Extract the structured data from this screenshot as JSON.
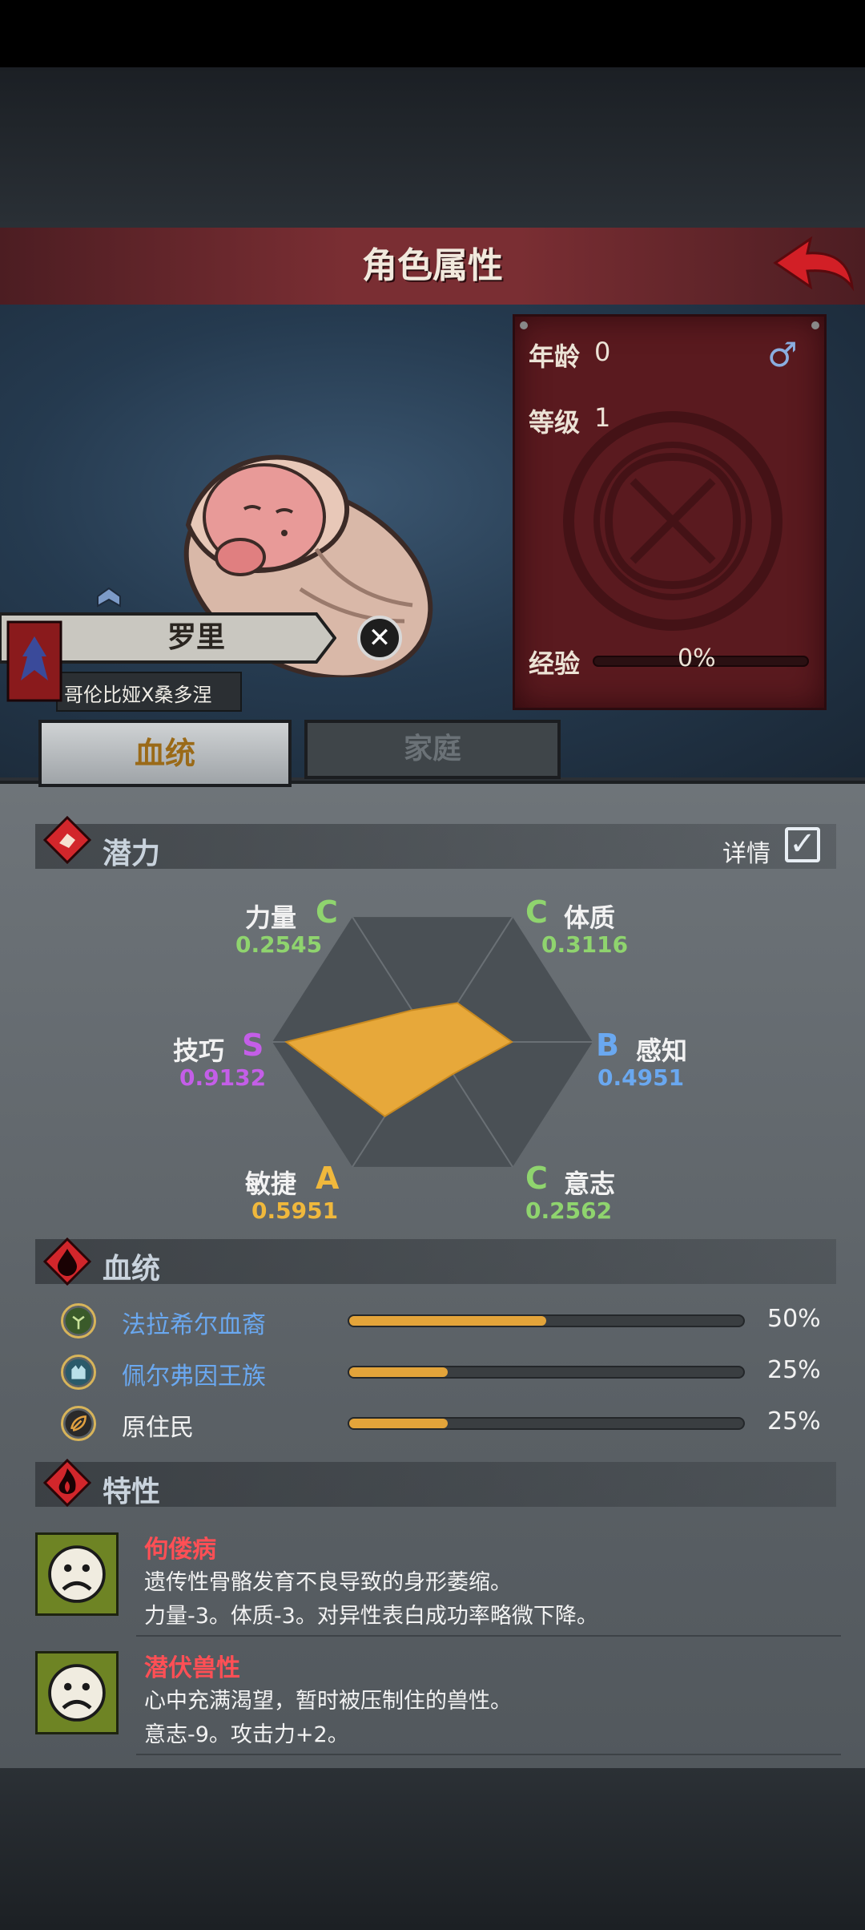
{
  "header": {
    "title": "角色属性"
  },
  "character": {
    "name": "罗里",
    "house": "哥伦比娅X桑多涅",
    "age_label": "年龄",
    "age_value": "0",
    "gender_symbol": "♂",
    "level_label": "等级",
    "level_value": "1",
    "exp_label": "经验",
    "exp_value": "0%",
    "exp_fraction": 0
  },
  "tabs": {
    "bloodline": "血统",
    "family": "家庭"
  },
  "potential": {
    "title": "潜力",
    "details_label": "详情",
    "details_checked": true,
    "stats": [
      {
        "name": "力量",
        "grade": "C",
        "value": "0.2545",
        "color": "#8fd46e"
      },
      {
        "name": "体质",
        "grade": "C",
        "value": "0.3116",
        "color": "#8fd46e"
      },
      {
        "name": "感知",
        "grade": "B",
        "value": "0.4951",
        "color": "#6aa8f0"
      },
      {
        "name": "意志",
        "grade": "C",
        "value": "0.2562",
        "color": "#8fd46e"
      },
      {
        "name": "敏捷",
        "grade": "A",
        "value": "0.5951",
        "color": "#f0b83c"
      },
      {
        "name": "技巧",
        "grade": "S",
        "value": "0.9132",
        "color": "#c45ee8"
      }
    ]
  },
  "bloodline": {
    "title": "血统",
    "rows": [
      {
        "name": "法拉希尔血裔",
        "percent": "50%",
        "fraction": 0.5,
        "name_color": "#6aa8f0",
        "icon": "tree-icon"
      },
      {
        "name": "佩尔弗因王族",
        "percent": "25%",
        "fraction": 0.25,
        "name_color": "#6aa8f0",
        "icon": "castle-icon"
      },
      {
        "name": "原住民",
        "percent": "25%",
        "fraction": 0.25,
        "name_color": "#f2f2f2",
        "icon": "leaf-icon"
      }
    ]
  },
  "traits": {
    "title": "特性",
    "items": [
      {
        "name": "佝偻病",
        "desc1": "遗传性骨骼发育不良导致的身形萎缩。",
        "desc2": "力量-3。体质-3。对异性表白成功率略微下降。"
      },
      {
        "name": "潜伏兽性",
        "desc1": "心中充满渴望，暂时被压制住的兽性。",
        "desc2": "意志-9。攻击力+2。"
      }
    ]
  }
}
